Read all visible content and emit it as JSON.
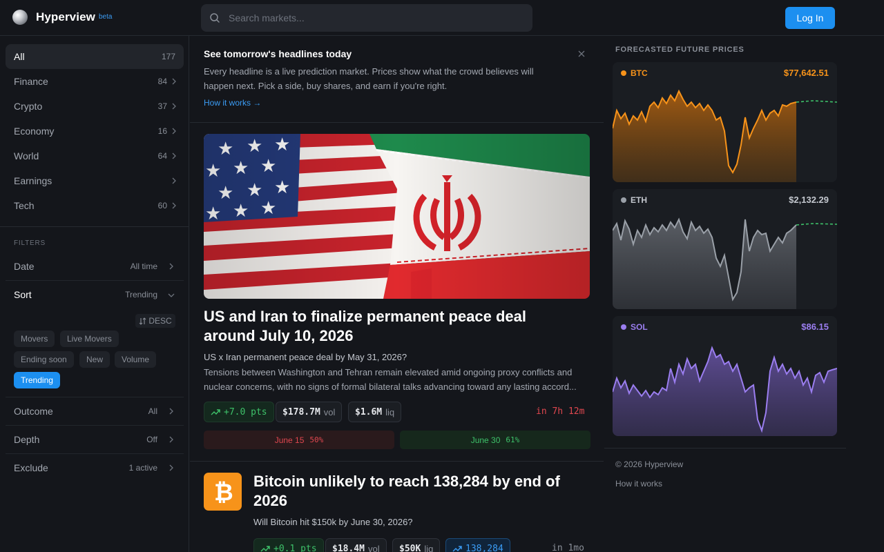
{
  "header": {
    "brand": "Hyperview",
    "badge": "beta",
    "search_placeholder": "Search markets...",
    "login_label": "Log In"
  },
  "sidebar": {
    "categories": [
      {
        "label": "All",
        "count": "177"
      },
      {
        "label": "Finance",
        "count": "84"
      },
      {
        "label": "Crypto",
        "count": "37"
      },
      {
        "label": "Economy",
        "count": "16"
      },
      {
        "label": "World",
        "count": "64"
      },
      {
        "label": "Earnings",
        "count": ""
      },
      {
        "label": "Tech",
        "count": "60"
      }
    ],
    "filters_heading": "FILTERS",
    "date": {
      "label": "Date",
      "value": "All time"
    },
    "sort": {
      "label": "Sort",
      "value": "Trending",
      "order": "DESC",
      "options": [
        "Movers",
        "Live Movers",
        "Ending soon",
        "New",
        "Volume",
        "Trending"
      ]
    },
    "outcome": {
      "label": "Outcome",
      "value": "All"
    },
    "depth": {
      "label": "Depth",
      "value": "Off"
    },
    "exclude": {
      "label": "Exclude",
      "value": "1 active"
    }
  },
  "intro": {
    "title": "See tomorrow's headlines today",
    "body": "Every headline is a live prediction market. Prices show what the crowd believes will happen next. Pick a side, buy shares, and earn if you're right.",
    "link": "How it works →"
  },
  "market1": {
    "headline": "US and Iran to finalize permanent peace deal around July 10, 2026",
    "subtitle": "US x Iran permanent peace deal by May 31, 2026?",
    "description": "Tensions between Washington and Tehran remain elevated amid ongoing proxy conflicts and nuclear concerns, with no signs of formal bilateral talks advancing toward any lasting accord...",
    "change": "+7.0 pts",
    "volume": "$178.7M",
    "volume_unit": "vol",
    "liquidity": "$1.6M",
    "liquidity_unit": "liq",
    "time_left": "in 7h 12m",
    "outcomes": [
      {
        "label": "June 15",
        "pct": "50%"
      },
      {
        "label": "June 30",
        "pct": "61%"
      }
    ]
  },
  "market2": {
    "headline": "Bitcoin unlikely to reach 138,284 by end of 2026",
    "subtitle": "Will Bitcoin hit $150k by June 30, 2026?",
    "change": "+0.1 pts",
    "volume": "$18.4M",
    "volume_unit": "vol",
    "liquidity": "$50K",
    "liquidity_unit": "liq",
    "target": "138,284",
    "time_left": "in 1mo"
  },
  "forecast": {
    "heading": "FORECASTED FUTURE PRICES",
    "assets": [
      {
        "symbol": "BTC",
        "price": "$77,642.51",
        "color": "#f7931a"
      },
      {
        "symbol": "ETH",
        "price": "$2,132.29",
        "color": "#9aa0a8"
      },
      {
        "symbol": "SOL",
        "price": "$86.15",
        "color": "#9b7ef0"
      }
    ]
  },
  "footer": {
    "copyright": "© 2026 Hyperview",
    "how_it_works": "How it works"
  },
  "colors": {
    "accent": "#1c8ff0",
    "up": "#3ec26a",
    "down": "#e0474f",
    "btc": "#f7931a",
    "sol": "#9b7ef0"
  }
}
